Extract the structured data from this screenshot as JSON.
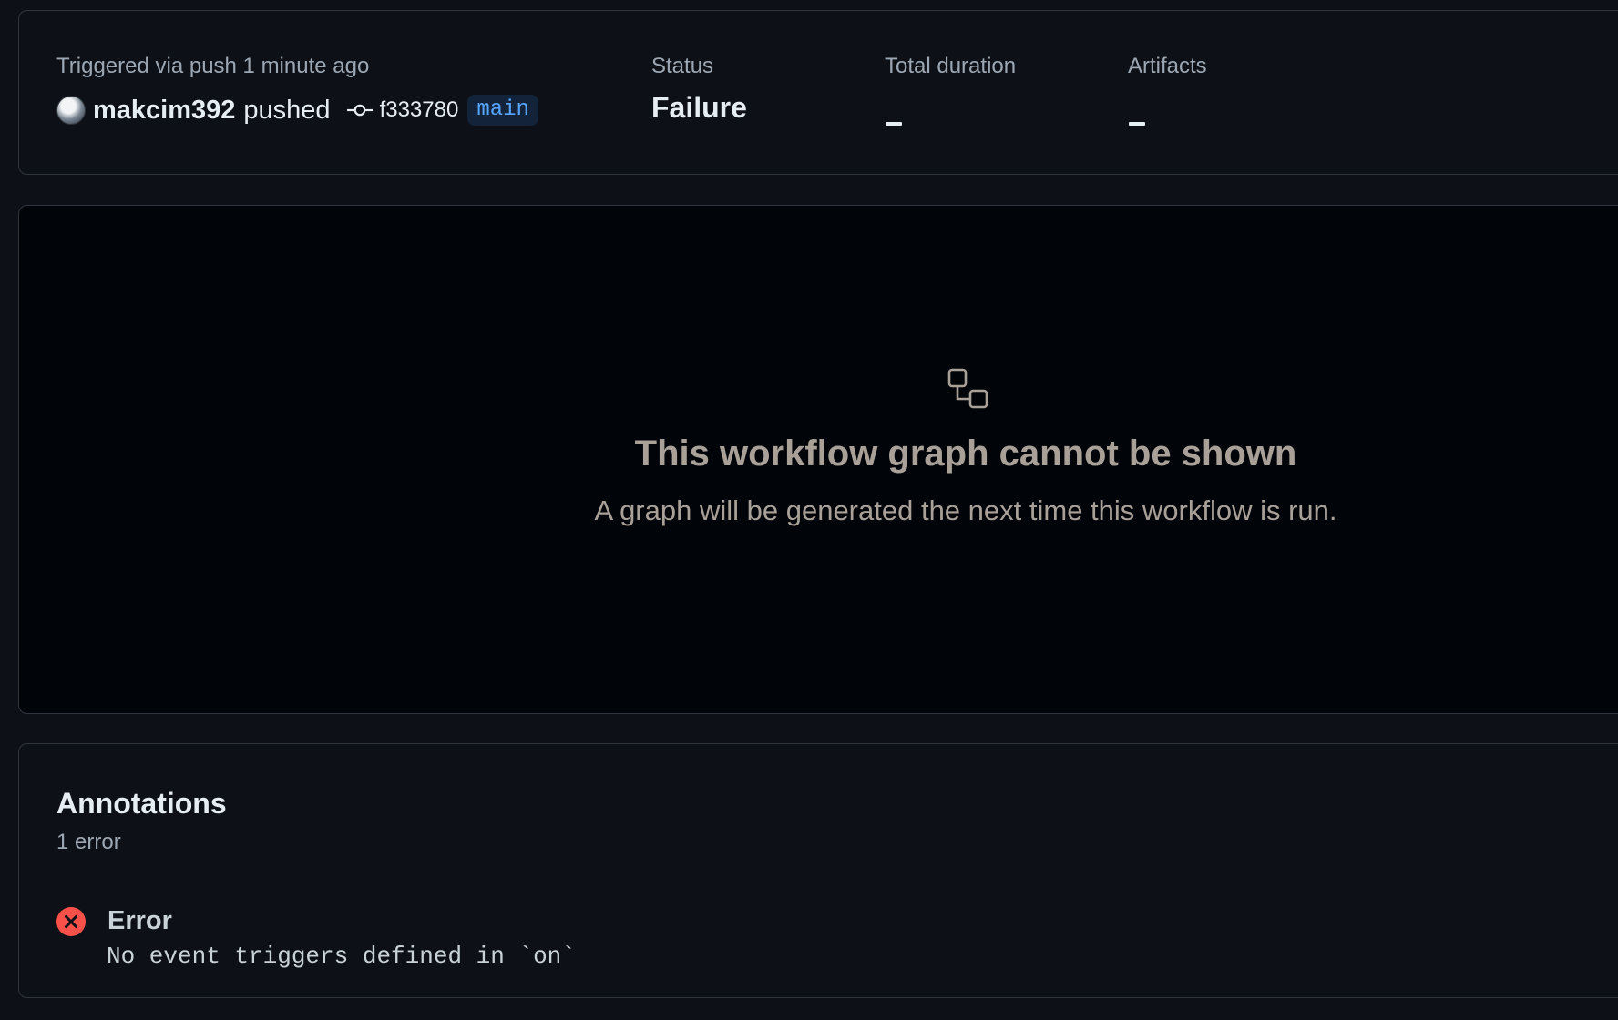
{
  "summary": {
    "trigger_label": "Triggered via push 1 minute ago",
    "actor": "makcim392",
    "action": "pushed",
    "commit_sha": "f333780",
    "branch": "main",
    "status_label": "Status",
    "status_value": "Failure",
    "duration_label": "Total duration",
    "artifacts_label": "Artifacts"
  },
  "graph": {
    "icon": "workflow-icon",
    "title": "This workflow graph cannot be shown",
    "subtitle": "A graph will be generated the next time this workflow is run."
  },
  "annotations": {
    "title": "Annotations",
    "count": "1 error",
    "items": [
      {
        "icon": "x-circle-icon",
        "level": "Error",
        "message": "No event triggers defined in `on`",
        "color": "#f85149"
      }
    ]
  },
  "colors": {
    "background": "#0d1117",
    "graph_background": "#010409",
    "border": "#30363d",
    "accent": "#58a6ff",
    "error": "#f85149"
  }
}
